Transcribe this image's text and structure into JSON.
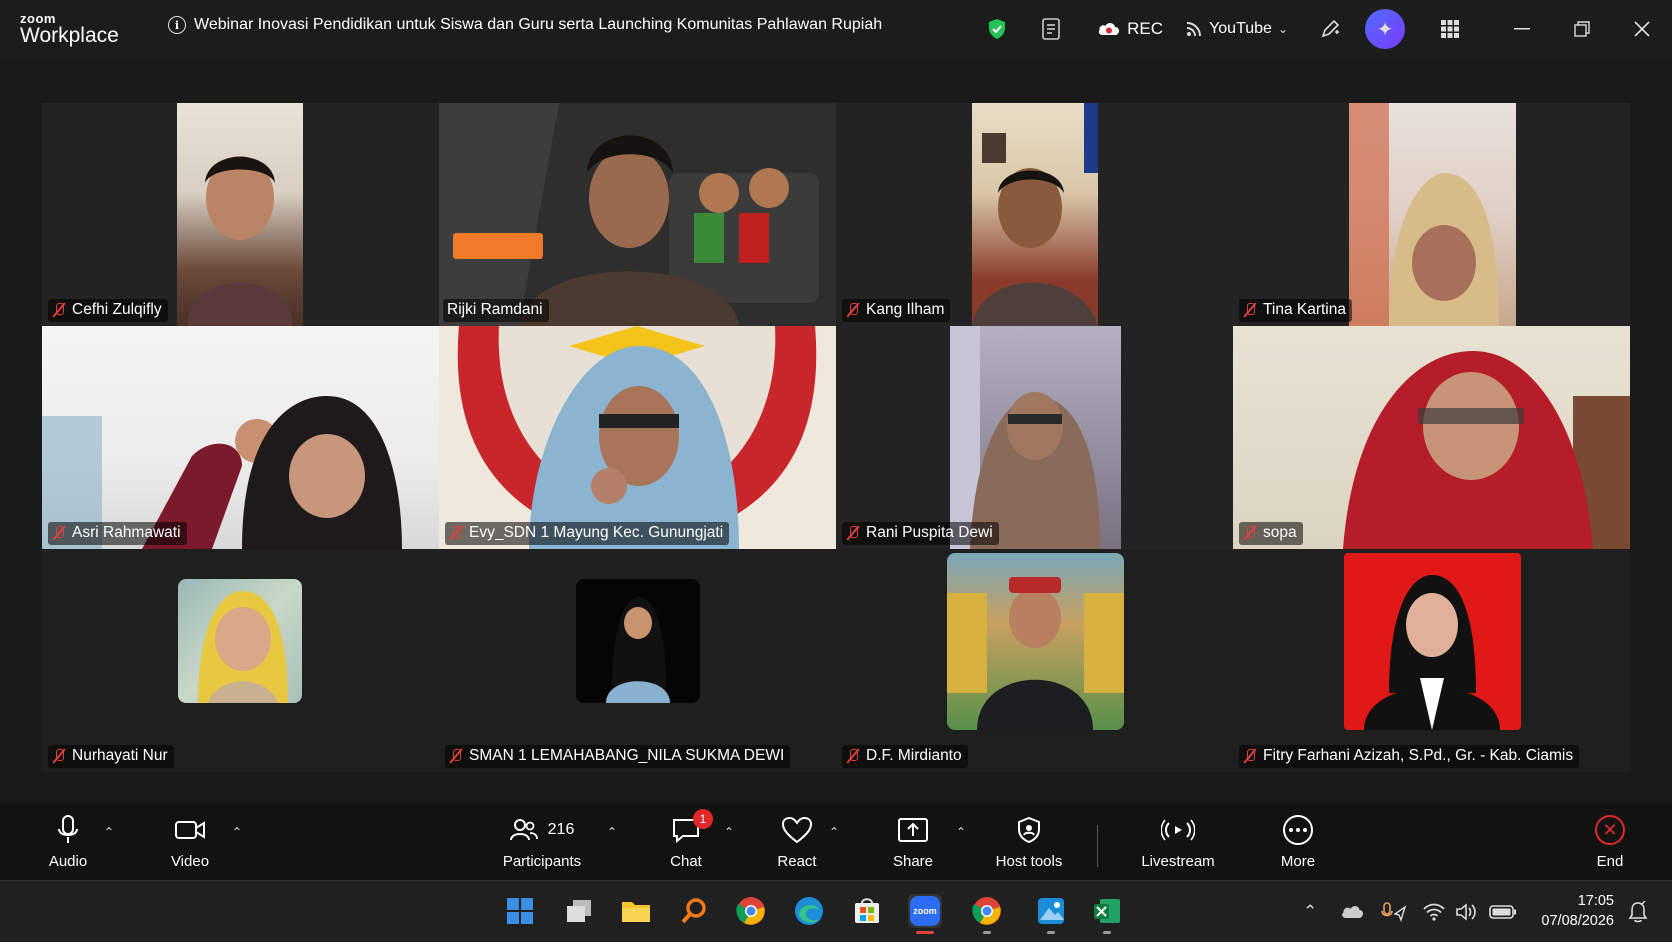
{
  "app": {
    "logo_small": "zoom",
    "logo_large": "Workplace"
  },
  "meeting": {
    "title": "Webinar Inovasi Pendidikan untuk Siswa dan Guru serta Launching Komunitas Pahlawan Rupiah"
  },
  "titlebar": {
    "rec_label": "REC",
    "stream_label": "YouTube"
  },
  "participants": [
    {
      "name": "Cefhi Zulqifly"
    },
    {
      "name": "Rijki Ramdani"
    },
    {
      "name": "Kang Ilham"
    },
    {
      "name": "Tina Kartina"
    },
    {
      "name": "Asri Rahmawati"
    },
    {
      "name": "Evy_SDN 1 Mayung Kec. Gunungjati"
    },
    {
      "name": "Rani Puspita Dewi"
    },
    {
      "name": "sopa"
    },
    {
      "name": "Nurhayati Nur"
    },
    {
      "name": "SMAN 1 LEMAHABANG_NILA SUKMA DEWI"
    },
    {
      "name": "D.F. Mirdianto"
    },
    {
      "name": "Fitry Farhani Azizah, S.Pd., Gr. - Kab. Ciamis"
    }
  ],
  "toolbar": {
    "audio": "Audio",
    "video": "Video",
    "participants_label": "Participants",
    "participants_count": "216",
    "chat": "Chat",
    "chat_badge": "1",
    "react": "React",
    "share": "Share",
    "host_tools": "Host tools",
    "livestream": "Livestream",
    "more": "More",
    "end": "End"
  },
  "taskbar": {
    "zoom_label": "zoom",
    "time": "17:05",
    "date": "07/08/2026"
  },
  "colors": {
    "active_speaker": "#23d18b",
    "end_red": "#e02828",
    "mute_red": "#e0413a"
  }
}
